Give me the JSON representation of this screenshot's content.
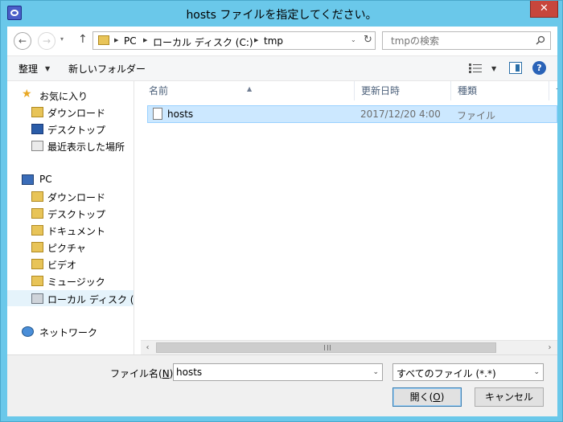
{
  "window": {
    "title": "hosts ファイルを指定してください。",
    "close_glyph": "✕"
  },
  "nav": {
    "back_glyph": "←",
    "forward_glyph": "→",
    "recent_glyph": "▾",
    "up_glyph": "↑",
    "address_segments": [
      "PC",
      "ローカル ディスク (C:)",
      "tmp"
    ],
    "address_sep": "▶",
    "address_dropdown": "⌄",
    "refresh_glyph": "↻",
    "search_placeholder": "tmpの検索"
  },
  "toolbar": {
    "organize_label": "整理",
    "organize_dropdown": "▼",
    "new_folder_label": "新しいフォルダー",
    "view_dropdown": "▼",
    "help_glyph": "?"
  },
  "sidebar": {
    "favorites_header": "お気に入り",
    "favorites": [
      "ダウンロード",
      "デスクトップ",
      "最近表示した場所"
    ],
    "pc_header": "PC",
    "pc_items": [
      "ダウンロード",
      "デスクトップ",
      "ドキュメント",
      "ピクチャ",
      "ビデオ",
      "ミュージック",
      "ローカル ディスク (C:)"
    ],
    "network_header": "ネットワーク",
    "selected": "ローカル ディスク (C:)"
  },
  "filelist": {
    "columns": [
      "名前",
      "更新日時",
      "種類",
      "サ"
    ],
    "sort_glyph": "▲",
    "rows": [
      {
        "name": "hosts",
        "modified": "2017/12/20 4:00",
        "type": "ファイル"
      }
    ]
  },
  "scrollbar": {
    "left_glyph": "‹",
    "right_glyph": "›"
  },
  "bottom": {
    "filename_label_prefix": "ファイル名(",
    "filename_label_key": "N",
    "filename_label_suffix": "):",
    "filename_value": "hosts",
    "combo_dropdown": "⌄",
    "filetype_value": "すべてのファイル (*.*)",
    "open_label_prefix": "開く(",
    "open_label_key": "O",
    "open_label_suffix": ")",
    "cancel_label": "キャンセル"
  }
}
